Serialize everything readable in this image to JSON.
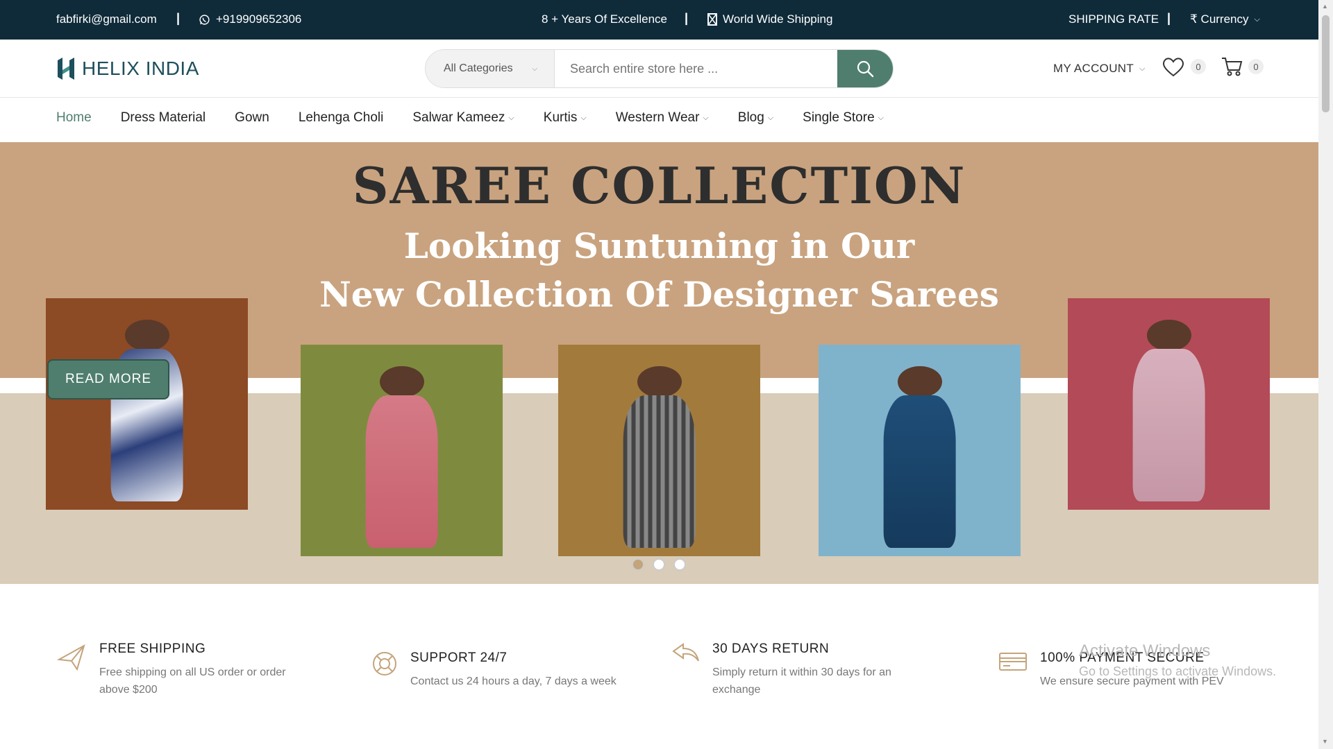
{
  "topbar": {
    "email": "fabfirki@gmail.com",
    "phone": "+919909652306",
    "excellence": "8 + Years Of Excellence",
    "shipping": "World Wide Shipping",
    "shipping_rate": "SHIPPING RATE",
    "currency": "₹ Currency",
    "separator": "|"
  },
  "header": {
    "logo": "HELIX INDIA",
    "category": "All Categories",
    "search_placeholder": "Search entire store here ...",
    "account": "MY ACCOUNT",
    "wishlist_count": "0",
    "cart_count": "0"
  },
  "nav": {
    "items": [
      {
        "label": "Home",
        "dropdown": false
      },
      {
        "label": "Dress Material",
        "dropdown": false
      },
      {
        "label": "Gown",
        "dropdown": false
      },
      {
        "label": "Lehenga Choli",
        "dropdown": false
      },
      {
        "label": "Salwar Kameez",
        "dropdown": true
      },
      {
        "label": "Kurtis",
        "dropdown": true
      },
      {
        "label": "Western Wear",
        "dropdown": true
      },
      {
        "label": "Blog",
        "dropdown": true
      },
      {
        "label": "Single Store",
        "dropdown": true
      }
    ]
  },
  "hero": {
    "title": "SAREE COLLECTION",
    "line1": "Looking Suntuning in Our",
    "line2": "New Collection Of Designer Sarees",
    "button": "READ MORE",
    "active_slide": 1,
    "slide_count": 3
  },
  "features": [
    {
      "icon": "plane-icon",
      "title": "FREE SHIPPING",
      "desc1": "Free shipping on all US order or order",
      "desc2": "above $200"
    },
    {
      "icon": "lifebuoy-icon",
      "title": "SUPPORT 24/7",
      "desc1": "Contact us 24 hours a day, 7 days a week",
      "desc2": ""
    },
    {
      "icon": "return-arrow-icon",
      "title": "30 DAYS RETURN",
      "desc1": "Simply return it within 30 days for an",
      "desc2": "exchange"
    },
    {
      "icon": "credit-card-icon",
      "title": "100% PAYMENT SECURE",
      "desc1": "We ensure secure payment with PEV",
      "desc2": ""
    }
  ],
  "watermark": {
    "line1": "Activate Windows",
    "line2": "Go to Settings to activate Windows."
  },
  "colors": {
    "topbar_bg": "#0f2b3a",
    "accent": "#4f7e6e",
    "hero_bg": "#c9a37f"
  }
}
